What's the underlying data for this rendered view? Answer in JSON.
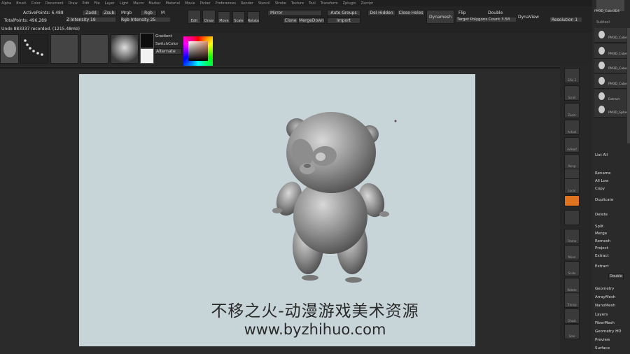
{
  "menu": [
    "Alpha",
    "Brush",
    "Color",
    "Document",
    "Draw",
    "Edit",
    "File",
    "Layer",
    "Light",
    "Macro",
    "Marker",
    "Material",
    "Movie",
    "Picker",
    "Preferences",
    "Render",
    "Stencil",
    "Stroke",
    "Texture",
    "Tool",
    "Transform",
    "Zplugin",
    "Zscript"
  ],
  "top": {
    "active_points_label": "ActivePoints: 6,488",
    "total_points_label": "TotalPoints: 496,289",
    "zadd": "Zadd",
    "zsub": "Zsub",
    "mrgb": "Mrgb",
    "rgb": "Rgb",
    "m": "M",
    "z_intensity": "Z Intensity 19",
    "rgb_intensity": "Rgb Intensity 25",
    "edit": "Edit",
    "draw": "Draw",
    "move": "Move",
    "scale": "Scale",
    "rotate": "Rotate",
    "mirror": "Mirror",
    "auto_groups": "Auto Groups",
    "clone": "Clone",
    "merge_down": "MergeDown",
    "import": "Import",
    "del_hidden": "Del Hidden",
    "close_holes": "Close Holes",
    "dynamesh": "Dynamesh",
    "flip": "Flip",
    "double": "Double",
    "target_polygons": "Target Polygons Count 3.58",
    "dynaview": "DynaView",
    "resolution": "Resolution 1",
    "status": "Undo 883337 recorded. (1215.48mb)"
  },
  "swatch": {
    "gradient": "Gradient",
    "switch_color": "SwitchColor",
    "alternate": "Alternate"
  },
  "subtool": {
    "title": "Subtool",
    "items": [
      "PM3D_Cube3D1",
      "PM3D_Cube",
      "PM3D_Cube",
      "PM3D_Cube",
      "Extract",
      "PM3D_Sphere"
    ],
    "top_item": "PM3D_Cube3D4"
  },
  "right_panel": {
    "list_all": "List All",
    "rename": "Rename",
    "all_low": "All Low",
    "copy": "Copy",
    "duplicate": "Duplicate",
    "delete": "Delete",
    "split": "Split",
    "merge": "Merge",
    "remesh": "Remesh",
    "project": "Project",
    "extract_header": "Extract",
    "extract": "Extract",
    "double": "Double",
    "sections": [
      "Geometry",
      "ArrayMesh",
      "NanoMesh",
      "Layers",
      "FiberMesh",
      "Geometry HD",
      "Preview",
      "Surface"
    ]
  },
  "shelf": [
    "SPix 3",
    "Scroll",
    "Zoom",
    "Actual",
    "AAHalf",
    "Persp",
    "Floor",
    "Local",
    "",
    "",
    "Frame",
    "Move",
    "Scale",
    "Rotate",
    "Transp",
    "Ghost",
    "Solo"
  ],
  "watermark": {
    "line1": "不移之火-动漫游戏美术资源",
    "line2": "www.byzhihuo.com"
  },
  "colors": {
    "accent": "#e0731d",
    "canvas_bg": "#c7d4d8",
    "panel_bg": "#2b2b2b"
  }
}
